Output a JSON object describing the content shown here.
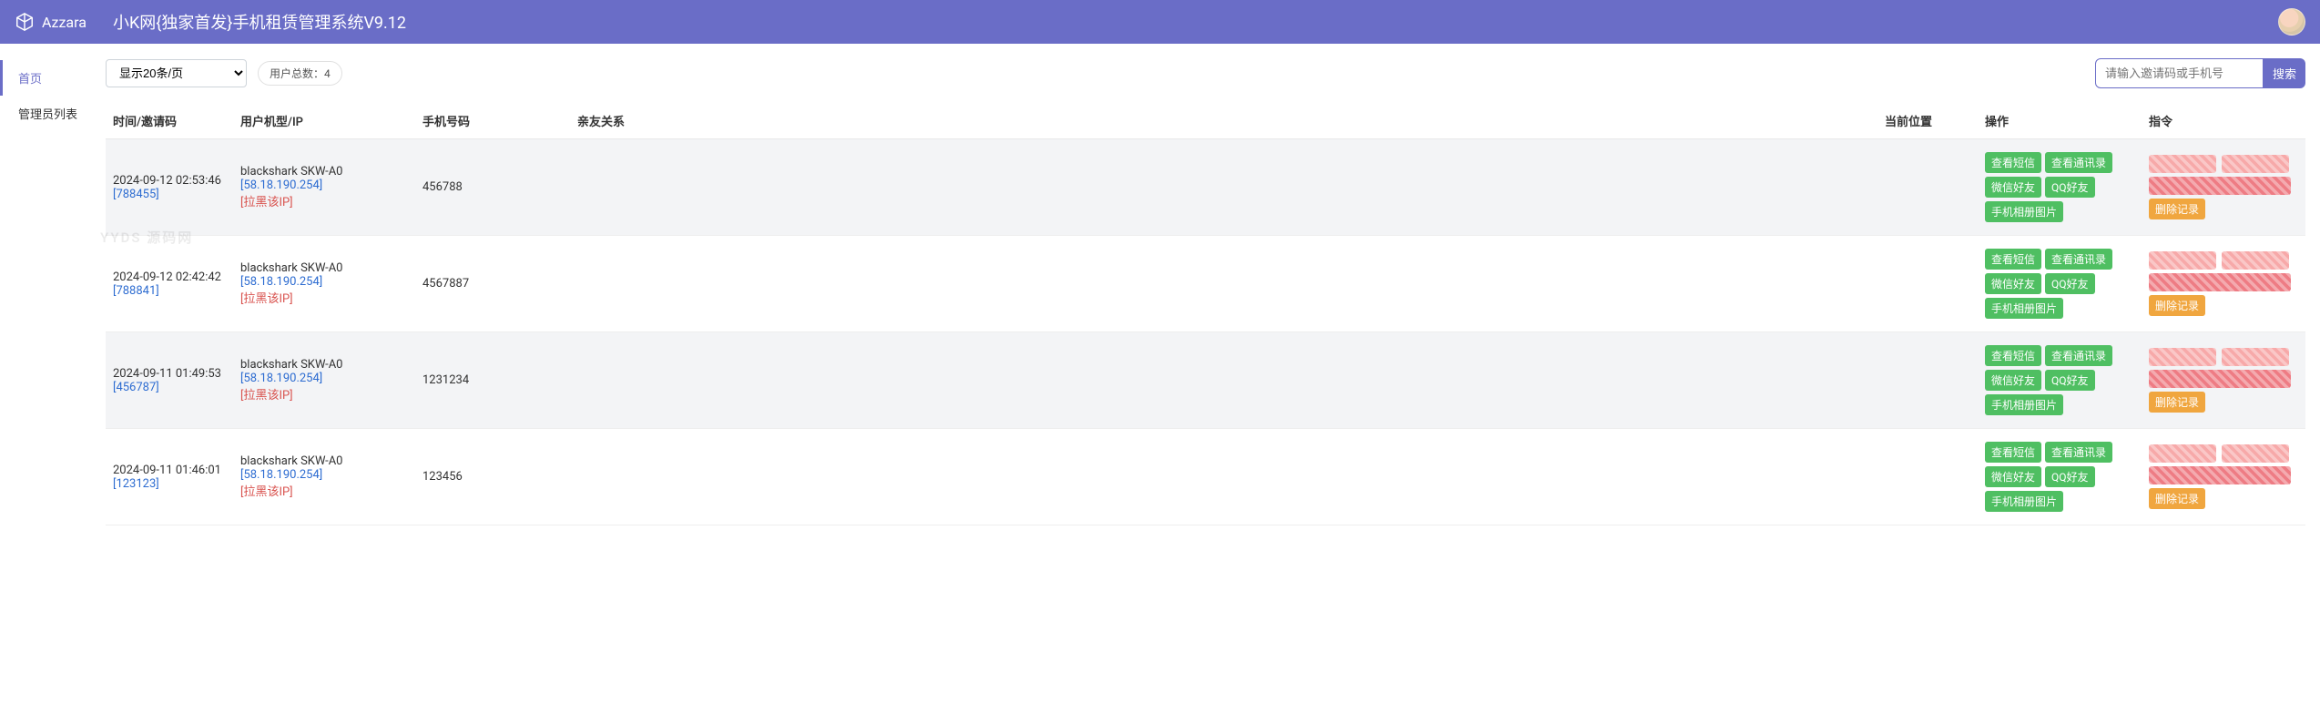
{
  "header": {
    "brand": "Azzara",
    "title": "小K网{独家首发}手机租赁管理系统V9.12"
  },
  "sidebar": {
    "items": [
      {
        "label": "首页",
        "active": true
      },
      {
        "label": "管理员列表",
        "active": false
      }
    ]
  },
  "toolbar": {
    "page_select": "显示20条/页",
    "user_count_label": "用户总数：",
    "user_count_value": "4",
    "search_placeholder": "请输入邀请码或手机号",
    "search_button": "搜索"
  },
  "watermark": "YYDS 源码网",
  "table": {
    "headers": {
      "time": "时间/邀请码",
      "device": "用户机型/IP",
      "phone": "手机号码",
      "relation": "亲友关系",
      "location": "当前位置",
      "ops": "操作",
      "cmd": "指令"
    },
    "op_buttons": [
      "查看短信",
      "查看通讯录",
      "微信好友",
      "QQ好友",
      "手机相册图片"
    ],
    "cmd_delete": "删除记录",
    "rows": [
      {
        "timestamp": "2024-09-12 02:53:46",
        "invite": "[788455]",
        "model": "blackshark SKW-A0",
        "ip": "[58.18.190.254]",
        "ipban": "[拉黑该IP]",
        "phone": "456788"
      },
      {
        "timestamp": "2024-09-12 02:42:42",
        "invite": "[788841]",
        "model": "blackshark SKW-A0",
        "ip": "[58.18.190.254]",
        "ipban": "[拉黑该IP]",
        "phone": "4567887"
      },
      {
        "timestamp": "2024-09-11 01:49:53",
        "invite": "[456787]",
        "model": "blackshark SKW-A0",
        "ip": "[58.18.190.254]",
        "ipban": "[拉黑该IP]",
        "phone": "1231234"
      },
      {
        "timestamp": "2024-09-11 01:46:01",
        "invite": "[123123]",
        "model": "blackshark SKW-A0",
        "ip": "[58.18.190.254]",
        "ipban": "[拉黑该IP]",
        "phone": "123456"
      }
    ]
  }
}
